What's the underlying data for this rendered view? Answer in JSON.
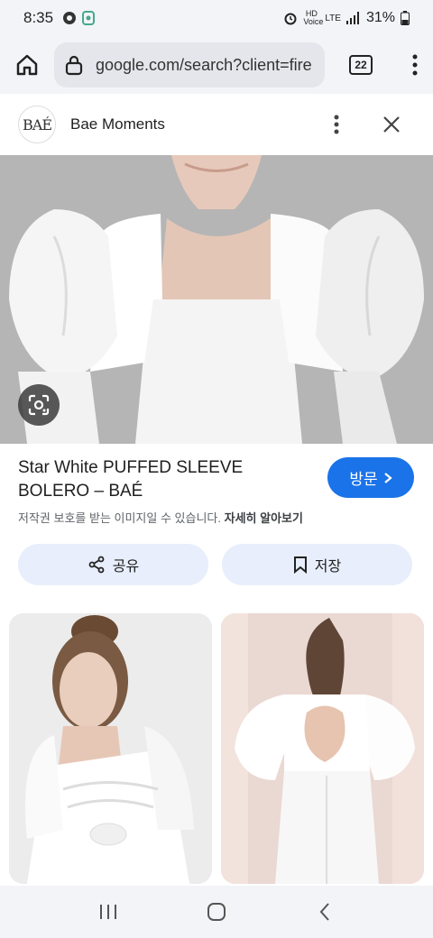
{
  "status_bar": {
    "time": "8:35",
    "battery": "31%",
    "hd_voice": "HD Voice",
    "lte": "LTE"
  },
  "browser": {
    "url": "google.com/search?client=fire",
    "tab_count": "22"
  },
  "source": {
    "logo_text": "BAÉ",
    "name": "Bae Moments"
  },
  "result": {
    "title": "Star White PUFFED SLEEVE BOLERO – BAÉ",
    "visit_label": "방문",
    "copyright_text": "저작권 보호를 받는 이미지일 수 있습니다.",
    "learn_more": "자세히 알아보기",
    "share_label": "공유",
    "save_label": "저장"
  },
  "colors": {
    "accent": "#1a73e8",
    "action_bg": "#e8eefb",
    "chrome_bg": "#f3f4f7"
  }
}
